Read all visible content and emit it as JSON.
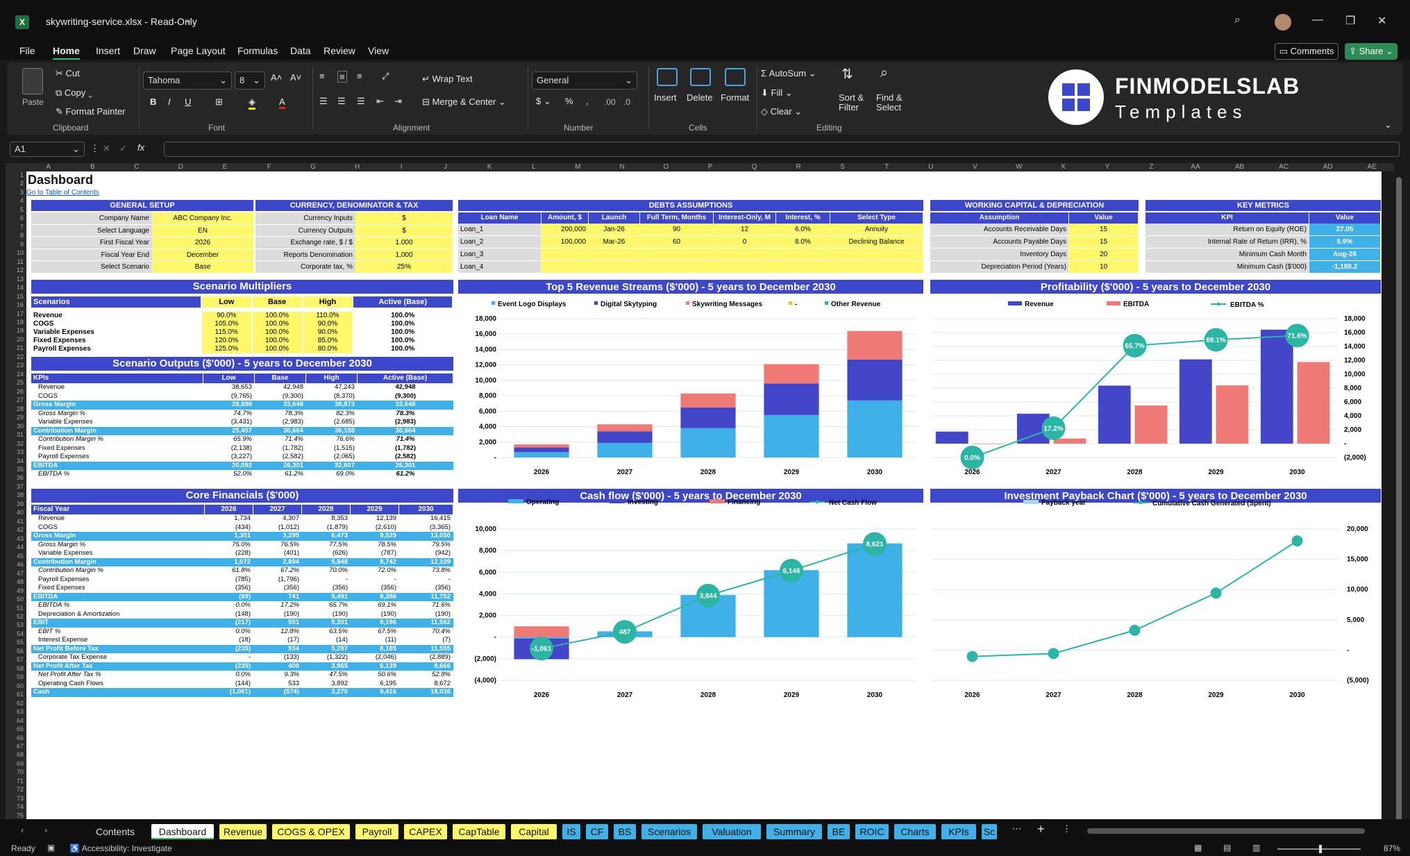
{
  "window": {
    "file_name": "skywriting-service.xlsx",
    "mode": "Read-Only"
  },
  "menu": [
    "File",
    "Home",
    "Insert",
    "Draw",
    "Page Layout",
    "Formulas",
    "Data",
    "Review",
    "View"
  ],
  "toolbar": {
    "comments": "Comments",
    "share": "Share"
  },
  "ribbon": {
    "clipboard": {
      "paste": "Paste",
      "cut": "Cut",
      "copy": "Copy",
      "format_painter": "Format Painter",
      "label": "Clipboard"
    },
    "font": {
      "family": "Tahoma",
      "size": "8",
      "label": "Font"
    },
    "alignment": {
      "wrap": "Wrap Text",
      "merge": "Merge & Center",
      "label": "Alignment"
    },
    "number": {
      "format": "General",
      "label": "Number"
    },
    "cells": {
      "insert": "Insert",
      "delete": "Delete",
      "format": "Format",
      "label": "Cells"
    },
    "editing": {
      "autosum": "AutoSum",
      "fill": "Fill",
      "clear": "Clear",
      "sort": "Sort & Filter",
      "find": "Find & Select",
      "label": "Editing"
    },
    "brand": {
      "title": "FINMODELSLAB",
      "subtitle": "Templates"
    }
  },
  "formula_bar": {
    "name_box": "A1",
    "fx": "fx"
  },
  "column_headers": [
    "A",
    "B",
    "C",
    "D",
    "E",
    "F",
    "G",
    "H",
    "I",
    "J",
    "K",
    "L",
    "M",
    "N",
    "O",
    "P",
    "Q",
    "R",
    "S",
    "T",
    "U",
    "V",
    "W",
    "X",
    "Y",
    "Z",
    "AA",
    "AB",
    "AC",
    "AD",
    "AE"
  ],
  "sheet": {
    "title": "Dashboard",
    "link": "Go to Table of Contents",
    "general_setup": {
      "title": "GENERAL SETUP",
      "rows": [
        [
          "Company Name",
          "ABC Company Inc."
        ],
        [
          "Select Language",
          "EN"
        ],
        [
          "First Fiscal Year",
          "2026"
        ],
        [
          "Fiscal Year End",
          "December"
        ],
        [
          "Select Scenario",
          "Base"
        ]
      ]
    },
    "currency": {
      "title": "CURRENCY, DENOMINATOR & TAX",
      "rows": [
        [
          "Currency Inputs",
          "$"
        ],
        [
          "Currency Outputs",
          "$"
        ],
        [
          "Exchange rate, $ / $",
          "1.000"
        ],
        [
          "Reports Denomination",
          "1,000"
        ],
        [
          "Corporate tax, %",
          "25%"
        ]
      ]
    },
    "debts": {
      "title": "DEBTS ASSUMPTIONS",
      "headers": [
        "Loan Name",
        "Amount, $",
        "Launch",
        "Full Term, Months",
        "Interest-Only, M",
        "Interest, %",
        "Select Type"
      ],
      "rows": [
        [
          "Loan_1",
          "200,000",
          "Jan-26",
          "90",
          "12",
          "6.0%",
          "Annuity"
        ],
        [
          "Loan_2",
          "100,000",
          "Mar-26",
          "60",
          "0",
          "8.0%",
          "Declining Balance"
        ],
        [
          "Loan_3",
          "",
          "",
          "",
          "",
          "",
          ""
        ],
        [
          "Loan_4",
          "",
          "",
          "",
          "",
          "",
          ""
        ]
      ]
    },
    "working_capital": {
      "title": "WORKING CAPITAL & DEPRECIATION",
      "headers": [
        "Assumption",
        "Value"
      ],
      "rows": [
        [
          "Accounts Receivable Days",
          "15"
        ],
        [
          "Accounts Payable Days",
          "15"
        ],
        [
          "Inventory Days",
          "20"
        ],
        [
          "Depreciation Period (Years)",
          "10"
        ]
      ]
    },
    "key_metrics": {
      "title": "KEY METRICS",
      "headers": [
        "KPI",
        "Value"
      ],
      "rows": [
        [
          "Return on Equity (ROE)",
          "27.05"
        ],
        [
          "Internal Rate of Return (IRR), %",
          "5.9%"
        ],
        [
          "Minimum Cash Month",
          "Aug-26"
        ],
        [
          "Minimum Cash ($'000)",
          "-1,188.2"
        ]
      ]
    },
    "scenario_mult": {
      "title": "Scenario Multipliers",
      "headers": [
        "Scenarios",
        "Low",
        "Base",
        "High",
        "Active (Base)"
      ],
      "rows": [
        [
          "Revenue",
          "90.0%",
          "100.0%",
          "110.0%",
          "100.0%"
        ],
        [
          "COGS",
          "105.0%",
          "100.0%",
          "90.0%",
          "100.0%"
        ],
        [
          "Variable Expenses",
          "115.0%",
          "100.0%",
          "90.0%",
          "100.0%"
        ],
        [
          "Fixed Expenses",
          "120.0%",
          "100.0%",
          "85.0%",
          "100.0%"
        ],
        [
          "Payroll Expenses",
          "125.0%",
          "100.0%",
          "80.0%",
          "100.0%"
        ]
      ]
    },
    "scenario_out": {
      "title": "Scenario Outputs ($'000) - 5 years to December 2030",
      "headers": [
        "KPIs",
        "Low",
        "Base",
        "High",
        "Active (Base)"
      ],
      "rows": [
        {
          "c": [
            "Revenue",
            "38,653",
            "42,948",
            "47,243",
            "42,948"
          ],
          "t": "n"
        },
        {
          "c": [
            "COGS",
            "(9,765)",
            "(9,300)",
            "(8,370)",
            "(9,300)"
          ],
          "t": "n"
        },
        {
          "c": [
            "Gross Margin",
            "28,888",
            "33,648",
            "38,873",
            "33,648"
          ],
          "t": "h"
        },
        {
          "c": [
            "Gross Margin %",
            "74.7%",
            "78.3%",
            "82.3%",
            "78.3%"
          ],
          "t": "i"
        },
        {
          "c": [
            "Variable Expenses",
            "(3,431)",
            "(2,983)",
            "(2,685)",
            "(2,983)"
          ],
          "t": "n"
        },
        {
          "c": [
            "Contribution Margin",
            "25,457",
            "30,664",
            "36,188",
            "30,664"
          ],
          "t": "h"
        },
        {
          "c": [
            "Contribution Margin %",
            "65.9%",
            "71.4%",
            "76.6%",
            "71.4%"
          ],
          "t": "i"
        },
        {
          "c": [
            "Fixed Expenses",
            "(2,138)",
            "(1,782)",
            "(1,515)",
            "(1,782)"
          ],
          "t": "n"
        },
        {
          "c": [
            "Payroll Expenses",
            "(3,227)",
            "(2,582)",
            "(2,065)",
            "(2,582)"
          ],
          "t": "n"
        },
        {
          "c": [
            "EBITDA",
            "20,092",
            "26,301",
            "32,607",
            "26,301"
          ],
          "t": "h"
        },
        {
          "c": [
            "EBITDA %",
            "52.0%",
            "61.2%",
            "69.0%",
            "61.2%"
          ],
          "t": "i"
        }
      ]
    },
    "core": {
      "title": "Core Financials ($'000)",
      "headers": [
        "Fiscal Year",
        "2026",
        "2027",
        "2028",
        "2029",
        "2030"
      ],
      "rows": [
        {
          "c": [
            "Revenue",
            "1,734",
            "4,307",
            "8,353",
            "12,139",
            "16,415"
          ],
          "t": "n"
        },
        {
          "c": [
            "COGS",
            "(434)",
            "(1,012)",
            "(1,879)",
            "(2,610)",
            "(3,365)"
          ],
          "t": "n"
        },
        {
          "c": [
            "Gross Margin",
            "1,301",
            "3,295",
            "6,473",
            "9,529",
            "13,050"
          ],
          "t": "h"
        },
        {
          "c": [
            "Gross Margin %",
            "75.0%",
            "76.5%",
            "77.5%",
            "78.5%",
            "79.5%"
          ],
          "t": "i"
        },
        {
          "c": [
            "Variable Expenses",
            "(228)",
            "(401)",
            "(626)",
            "(787)",
            "(942)"
          ],
          "t": "n"
        },
        {
          "c": [
            "Contribution Margin",
            "1,072",
            "2,894",
            "5,848",
            "8,742",
            "12,109"
          ],
          "t": "h"
        },
        {
          "c": [
            "Contribution Margin %",
            "61.8%",
            "67.2%",
            "70.0%",
            "72.0%",
            "73.8%"
          ],
          "t": "i"
        },
        {
          "c": [
            "Payroll Expenses",
            "(785)",
            "(1,796)",
            "-",
            "-",
            "-"
          ],
          "t": "n"
        },
        {
          "c": [
            "Fixed Expenses",
            "(356)",
            "(356)",
            "(356)",
            "(356)",
            "(356)"
          ],
          "t": "n"
        },
        {
          "c": [
            "EBITDA",
            "(69)",
            "741",
            "5,491",
            "8,386",
            "11,752"
          ],
          "t": "h"
        },
        {
          "c": [
            "EBITDA %",
            "0.0%",
            "17.2%",
            "65.7%",
            "69.1%",
            "71.6%"
          ],
          "t": "i"
        },
        {
          "c": [
            "Depreciation & Amortization",
            "(148)",
            "(190)",
            "(190)",
            "(190)",
            "(190)"
          ],
          "t": "n"
        },
        {
          "c": [
            "EBIT",
            "(217)",
            "551",
            "5,301",
            "8,196",
            "11,562"
          ],
          "t": "h"
        },
        {
          "c": [
            "EBIT %",
            "0.0%",
            "12.8%",
            "63.5%",
            "67.5%",
            "70.4%"
          ],
          "t": "i"
        },
        {
          "c": [
            "Interest Expense",
            "(18)",
            "(17)",
            "(14)",
            "(11)",
            "(7)"
          ],
          "t": "n"
        },
        {
          "c": [
            "Net Profit Before Tax",
            "(235)",
            "534",
            "5,287",
            "8,185",
            "11,555"
          ],
          "t": "h"
        },
        {
          "c": [
            "Corporate Tax Expense",
            "-",
            "(133)",
            "(1,322)",
            "(2,046)",
            "(2,889)"
          ],
          "t": "n"
        },
        {
          "c": [
            "Net Profit After Tax",
            "(235)",
            "400",
            "3,965",
            "6,139",
            "8,666"
          ],
          "t": "h"
        },
        {
          "c": [
            "Net Profit After Tax %",
            "0.0%",
            "9.3%",
            "47.5%",
            "50.6%",
            "52.8%"
          ],
          "t": "i"
        },
        {
          "c": [
            "Operating Cash Flows",
            "(144)",
            "533",
            "3,892",
            "6,195",
            "8,672"
          ],
          "t": "n"
        },
        {
          "c": [
            "Cash",
            "(1,061)",
            "(574)",
            "3,270",
            "9,416",
            "18,036"
          ],
          "t": "h"
        }
      ]
    }
  },
  "chart_data": [
    {
      "type": "bar",
      "title": "Top 5 Revenue Streams ($'000) - 5 years to December 2030",
      "categories": [
        "2026",
        "2027",
        "2028",
        "2029",
        "2030"
      ],
      "ylim": [
        0,
        18000
      ],
      "yticks": [
        "18,000",
        "16,000",
        "14,000",
        "12,000",
        "10,000",
        "8,000",
        "6,000",
        "4,000",
        "2,000",
        "-"
      ],
      "series": [
        {
          "name": "Event Logo Displays",
          "color": "#3fb0e8",
          "values": [
            700,
            1900,
            3800,
            5500,
            7400
          ]
        },
        {
          "name": "Digital Skytyping",
          "color": "#4346c9",
          "values": [
            600,
            1500,
            2700,
            4100,
            5300
          ]
        },
        {
          "name": "Skywriting Messages",
          "color": "#ef7a75",
          "values": [
            400,
            900,
            1800,
            2500,
            3700
          ]
        },
        {
          "name": "-",
          "color": "#f2c12e",
          "values": [
            0,
            0,
            0,
            0,
            0
          ]
        },
        {
          "name": "Other Revenue",
          "color": "#2bb5a3",
          "values": [
            0,
            0,
            0,
            0,
            0
          ]
        }
      ]
    },
    {
      "type": "bar",
      "title": "Profitability ($'000) - 5 years to December 2030",
      "categories": [
        "2026",
        "2027",
        "2028",
        "2029",
        "2030"
      ],
      "ylim": [
        -2000,
        18000
      ],
      "yticks": [
        "18,000",
        "16,000",
        "14,000",
        "12,000",
        "10,000",
        "8,000",
        "6,000",
        "4,000",
        "2,000",
        "-",
        "(2,000)"
      ],
      "series": [
        {
          "name": "Revenue",
          "color": "#4346c9",
          "values": [
            1734,
            4307,
            8353,
            12139,
            16415
          ]
        },
        {
          "name": "EBITDA",
          "color": "#ef7a75",
          "values": [
            -69,
            741,
            5491,
            8386,
            11752
          ]
        },
        {
          "name": "EBITDA %",
          "color": "#2bb5a3",
          "values": [
            0.0,
            17.2,
            65.7,
            69.1,
            71.6
          ],
          "labels": [
            "0.0%",
            "17.2%",
            "65.7%",
            "69.1%",
            "71.6%"
          ]
        }
      ]
    },
    {
      "type": "bar",
      "title": "Cash flow ($'000) - 5 years to December 2030",
      "categories": [
        "2026",
        "2027",
        "2028",
        "2029",
        "2030"
      ],
      "ylim": [
        -4000,
        10000
      ],
      "yticks": [
        "10,000",
        "8,000",
        "6,000",
        "4,000",
        "2,000",
        "-",
        "(2,000)",
        "(4,000)"
      ],
      "series": [
        {
          "name": "Operating",
          "color": "#3fb0e8",
          "values": [
            -144,
            533,
            3892,
            6195,
            8672
          ]
        },
        {
          "name": "Investing",
          "color": "#4346c9",
          "values": [
            -1900,
            0,
            0,
            0,
            0
          ]
        },
        {
          "name": "Financing",
          "color": "#ef7a75",
          "values": [
            1000,
            0,
            0,
            0,
            0
          ]
        },
        {
          "name": "Net Cash Flow",
          "color": "#2bb5a3",
          "values": [
            -1061,
            487,
            3844,
            6146,
            8621
          ],
          "labels": [
            "-1,061",
            "487",
            "3,844",
            "6,146",
            "8,621"
          ]
        }
      ]
    },
    {
      "type": "line",
      "title": "Investment Payback Chart ($'000) - 5 years to December 2030",
      "categories": [
        "2026",
        "2027",
        "2028",
        "2029",
        "2030"
      ],
      "ylim": [
        -5000,
        20000
      ],
      "yticks": [
        "20,000",
        "15,000",
        "10,000",
        "5,000",
        "-",
        "(5,000)"
      ],
      "series": [
        {
          "name": "Payback year",
          "color": "#a8d8f0",
          "values": [
            0,
            0,
            1,
            0,
            0
          ]
        },
        {
          "name": "Cumulative Cash Generated (Spent)",
          "color": "#2bb5a3",
          "values": [
            -1061,
            -574,
            3270,
            9416,
            18036
          ]
        }
      ]
    }
  ],
  "tabs": [
    {
      "label": "Contents",
      "style": "plain"
    },
    {
      "label": "Dashboard",
      "style": "act"
    },
    {
      "label": "Revenue",
      "style": "y"
    },
    {
      "label": "COGS & OPEX",
      "style": "y"
    },
    {
      "label": "Payroll",
      "style": "y"
    },
    {
      "label": "CAPEX",
      "style": "y"
    },
    {
      "label": "CapTable",
      "style": "y"
    },
    {
      "label": "Capital",
      "style": "y"
    },
    {
      "label": "IS",
      "style": "b"
    },
    {
      "label": "CF",
      "style": "b"
    },
    {
      "label": "BS",
      "style": "b"
    },
    {
      "label": "Scenarios",
      "style": "b"
    },
    {
      "label": "Valuation",
      "style": "b"
    },
    {
      "label": "Summary",
      "style": "b"
    },
    {
      "label": "BE",
      "style": "b"
    },
    {
      "label": "ROIC",
      "style": "b"
    },
    {
      "label": "Charts",
      "style": "b"
    },
    {
      "label": "KPIs",
      "style": "b"
    },
    {
      "label": "Sc",
      "style": "b"
    }
  ],
  "status": {
    "ready": "Ready",
    "accessibility": "Accessibility: Investigate",
    "zoom": "87%"
  }
}
